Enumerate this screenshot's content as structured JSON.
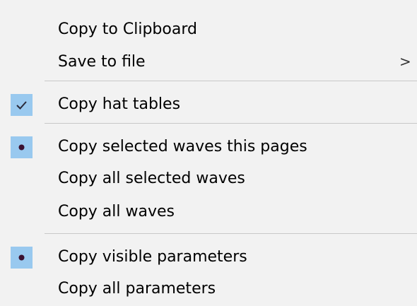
{
  "menu": {
    "items": [
      {
        "label": "Copy to Clipboard"
      },
      {
        "label": "Save to file",
        "submenu_arrow": ">"
      },
      {
        "label": "Copy hat tables",
        "state": "checked"
      },
      {
        "label": "Copy selected waves this pages",
        "state": "radio-selected"
      },
      {
        "label": "Copy all selected waves"
      },
      {
        "label": "Copy all waves"
      },
      {
        "label": "Copy visible parameters",
        "state": "radio-selected"
      },
      {
        "label": "Copy all parameters"
      }
    ]
  },
  "colors": {
    "menu_background": "#f2f2f2",
    "check_highlight": "#99c9ef",
    "check_glyph": "#2a2a3a",
    "radio_dot": "#3a1030",
    "separator": "#c8c8c8"
  },
  "icons": {
    "check": "checkmark-icon",
    "radio": "radio-dot-icon",
    "submenu": "chevron-right-icon"
  }
}
